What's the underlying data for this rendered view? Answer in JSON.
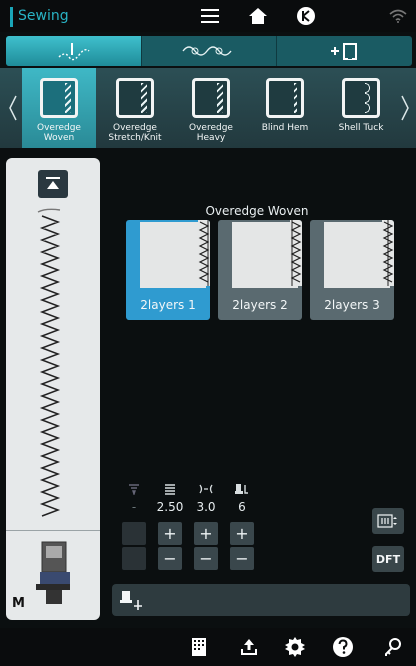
{
  "topbar": {
    "title": "Sewing"
  },
  "tabs": [
    {
      "name": "utility-stitches",
      "active": true
    },
    {
      "name": "decorative-stitches",
      "active": false
    },
    {
      "name": "buttonholes",
      "active": false
    }
  ],
  "stitches": [
    {
      "label": "Overedge\nWoven",
      "selected": true
    },
    {
      "label": "Overedge\nStretch/Knit",
      "selected": false
    },
    {
      "label": "Overedge\nHeavy",
      "selected": false
    },
    {
      "label": "Blind Hem",
      "selected": false
    },
    {
      "label": "Shell Tuck",
      "selected": false
    }
  ],
  "preview": {
    "presser_foot_label": "M"
  },
  "main": {
    "title": "Overedge Woven",
    "options": [
      {
        "label": "2layers 1",
        "active": true
      },
      {
        "label": "2layers 2",
        "active": false
      },
      {
        "label": "2layers 3",
        "active": false
      }
    ]
  },
  "settings": {
    "tension_value": "-",
    "length_value": "2.50",
    "width_value": "3.0",
    "foot_pressure_value": "6"
  },
  "side_buttons": {
    "dft_label": "DFT"
  },
  "colors": {
    "accent": "#29b3c4",
    "selected": "#2f9bd0",
    "panel": "#e6e9ea"
  }
}
